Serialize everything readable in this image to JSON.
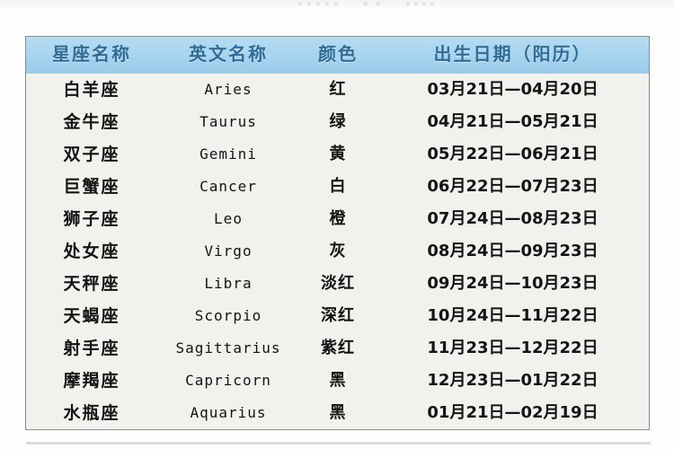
{
  "page": {
    "background_color": "#fdfdfd",
    "top_artifact_note": "faint cut-off row of text at the top edge, illegible"
  },
  "table": {
    "name": "zodiac-sign-table",
    "header_background": "#a6d3ee",
    "header_text_color": "#2f6d97",
    "cell_background": "#f1f1ed",
    "border_color": "#7d7d79",
    "columns": [
      {
        "key": "name",
        "label": "星座名称"
      },
      {
        "key": "en",
        "label": "英文名称"
      },
      {
        "key": "color",
        "label": "颜色"
      },
      {
        "key": "date",
        "label": "出生日期（阳历）"
      }
    ],
    "rows": [
      {
        "name": "白羊座",
        "en": "Aries",
        "color": "红",
        "date": "03月21日—04月20日"
      },
      {
        "name": "金牛座",
        "en": "Taurus",
        "color": "绿",
        "date": "04月21日—05月21日"
      },
      {
        "name": "双子座",
        "en": "Gemini",
        "color": "黄",
        "date": "05月22日—06月21日"
      },
      {
        "name": "巨蟹座",
        "en": "Cancer",
        "color": "白",
        "date": "06月22日—07月23日"
      },
      {
        "name": "狮子座",
        "en": "Leo",
        "color": "橙",
        "date": "07月24日—08月23日"
      },
      {
        "name": "处女座",
        "en": "Virgo",
        "color": "灰",
        "date": "08月24日—09月23日"
      },
      {
        "name": "天秤座",
        "en": "Libra",
        "color": "淡红",
        "date": "09月24日—10月23日"
      },
      {
        "name": "天蝎座",
        "en": "Scorpio",
        "color": "深红",
        "date": "10月24日—11月22日"
      },
      {
        "name": "射手座",
        "en": "Sagittarius",
        "color": "紫红",
        "date": "11月23日—12月22日"
      },
      {
        "name": "摩羯座",
        "en": "Capricorn",
        "color": "黑",
        "date": "12月23日—01月22日"
      },
      {
        "name": "水瓶座",
        "en": "Aquarius",
        "color": "黑",
        "date": "01月21日—02月19日"
      }
    ]
  }
}
